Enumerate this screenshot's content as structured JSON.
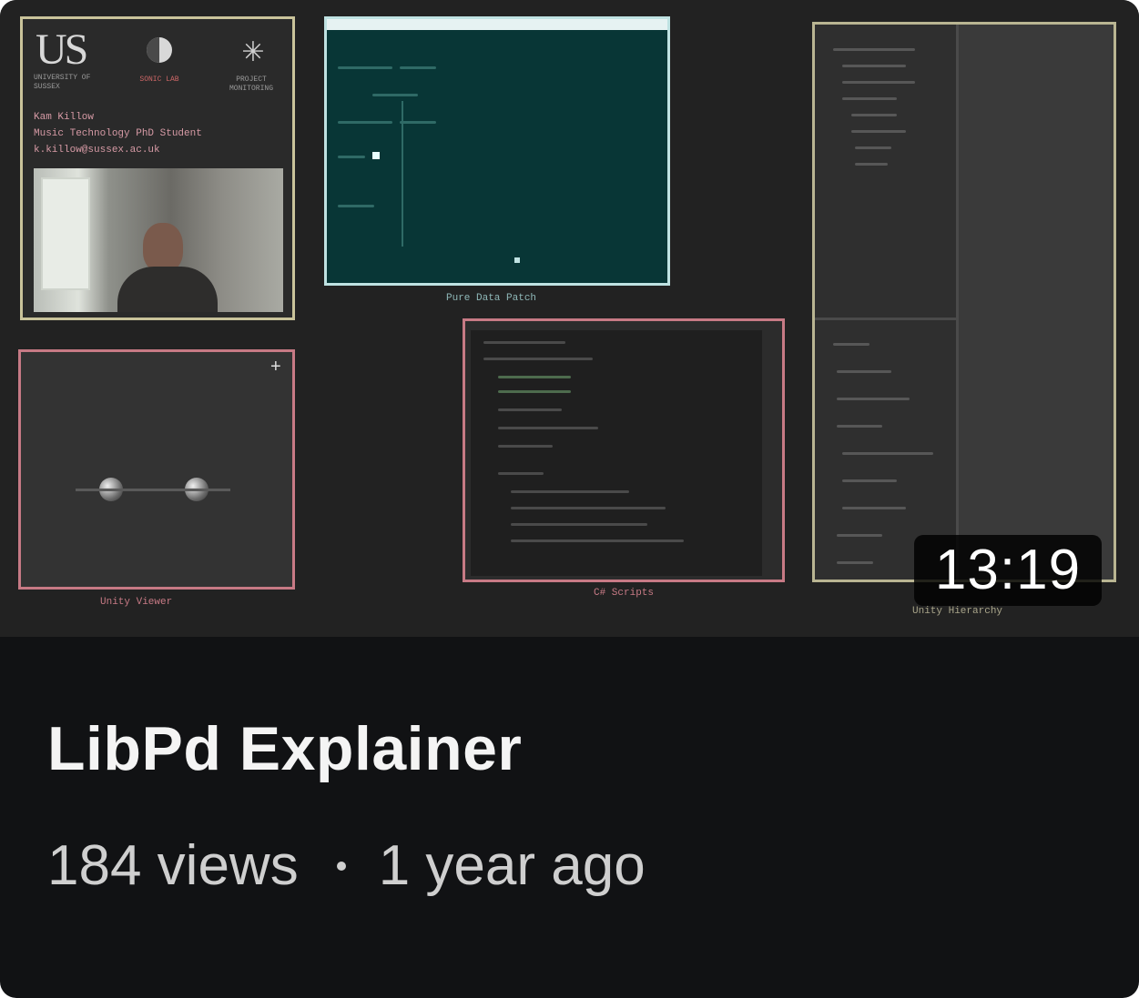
{
  "video": {
    "title": "LibPd Explainer",
    "views": "184 views",
    "age": "1 year ago",
    "duration": "13:19"
  },
  "thumbnail": {
    "logo": "US",
    "logo_sub": "UNIVERSITY OF SUSSEX",
    "icon1_label": "SONIC LAB",
    "icon2_label": "PROJECT MONITORING",
    "presenter_name": "Kam Killow",
    "presenter_role": "Music Technology PhD Student",
    "presenter_email": "k.killow@sussex.ac.uk",
    "patch_caption": "Pure Data Patch",
    "unity_caption": "Unity Viewer",
    "scripts_caption": "C# Scripts",
    "hierarchy_caption": "Unity Hierarchy"
  },
  "colors": {
    "card_bg": "#111214",
    "thumb_bg": "#222222",
    "gold": "#c9c39a",
    "pink": "#c77a85",
    "teal_panel": "#083636",
    "text_primary": "#f4f4f4",
    "text_secondary": "#cfcfcf"
  }
}
